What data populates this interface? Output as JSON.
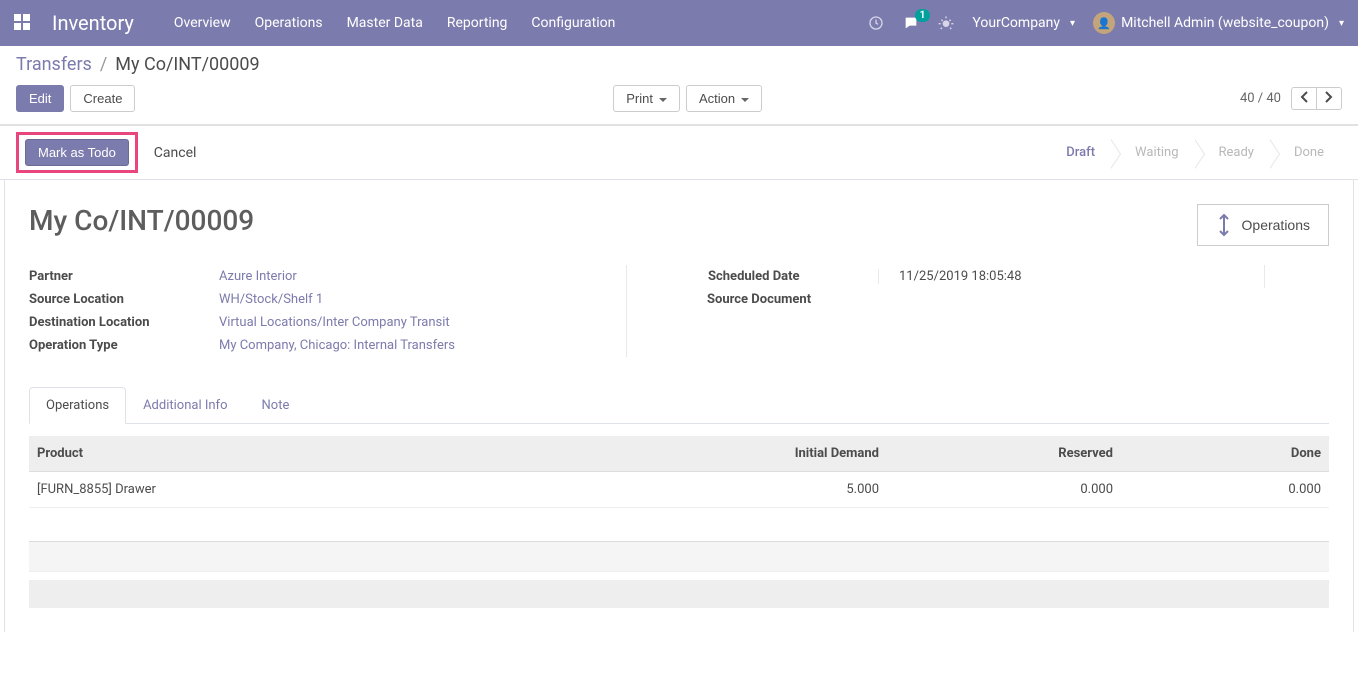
{
  "navbar": {
    "brand": "Inventory",
    "menu": [
      "Overview",
      "Operations",
      "Master Data",
      "Reporting",
      "Configuration"
    ],
    "msg_count": "1",
    "company": "YourCompany",
    "user": "Mitchell Admin (website_coupon)"
  },
  "breadcrumb": {
    "parent": "Transfers",
    "current": "My Co/INT/00009"
  },
  "buttons": {
    "edit": "Edit",
    "create": "Create",
    "print": "Print",
    "action": "Action",
    "mark_todo": "Mark as Todo",
    "cancel": "Cancel"
  },
  "pager": {
    "text": "40 / 40"
  },
  "status": {
    "steps": [
      "Draft",
      "Waiting",
      "Ready",
      "Done"
    ],
    "active_index": 0
  },
  "form": {
    "title": "My Co/INT/00009",
    "operations_btn": "Operations",
    "left": {
      "partner_label": "Partner",
      "partner": "Azure Interior",
      "src_loc_label": "Source Location",
      "src_loc": "WH/Stock/Shelf 1",
      "dst_loc_label": "Destination Location",
      "dst_loc": "Virtual Locations/Inter Company Transit",
      "op_type_label": "Operation Type",
      "op_type": "My Company, Chicago: Internal Transfers"
    },
    "right": {
      "sched_label": "Scheduled Date",
      "sched": "11/25/2019 18:05:48",
      "srcdoc_label": "Source Document",
      "srcdoc": ""
    }
  },
  "tabs": [
    "Operations",
    "Additional Info",
    "Note"
  ],
  "table": {
    "cols": {
      "product": "Product",
      "demand": "Initial Demand",
      "reserved": "Reserved",
      "done": "Done"
    },
    "rows": [
      {
        "product": "[FURN_8855] Drawer",
        "demand": "5.000",
        "reserved": "0.000",
        "done": "0.000"
      }
    ]
  }
}
